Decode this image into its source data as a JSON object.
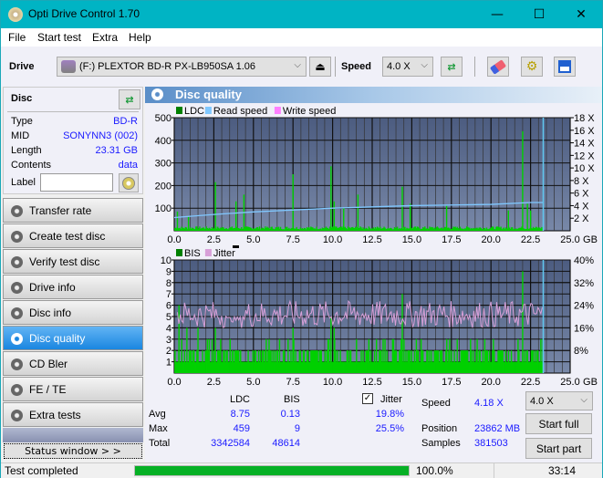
{
  "window": {
    "title": "Opti Drive Control 1.70",
    "minimize": "—",
    "maximize": "☐",
    "close": "✕"
  },
  "menu": {
    "file": "File",
    "start_test": "Start test",
    "extra": "Extra",
    "help": "Help"
  },
  "toolbar": {
    "drive_label": "Drive",
    "drive_value": "(F:)  PLEXTOR BD-R  PX-LB950SA 1.06",
    "speed_label": "Speed",
    "speed_value": "4.0 X"
  },
  "disc": {
    "title": "Disc",
    "type_label": "Type",
    "type_value": "BD-R",
    "mid_label": "MID",
    "mid_value": "SONYNN3 (002)",
    "length_label": "Length",
    "length_value": "23.31 GB",
    "contents_label": "Contents",
    "contents_value": "data",
    "label_label": "Label",
    "label_value": ""
  },
  "nav": [
    {
      "label": "Transfer rate",
      "active": false
    },
    {
      "label": "Create test disc",
      "active": false
    },
    {
      "label": "Verify test disc",
      "active": false
    },
    {
      "label": "Drive info",
      "active": false
    },
    {
      "label": "Disc info",
      "active": false
    },
    {
      "label": "Disc quality",
      "active": true
    },
    {
      "label": "CD Bler",
      "active": false
    },
    {
      "label": "FE / TE",
      "active": false
    },
    {
      "label": "Extra tests",
      "active": false
    }
  ],
  "status_window_label": "Status window > >",
  "main": {
    "title": "Disc quality"
  },
  "colors": {
    "ldc": "#008000",
    "read_speed": "#80c8ff",
    "write_speed": "#ff80ff",
    "bis": "#008000",
    "jitter": "#d8a0d8",
    "bars": "#00d000",
    "progress": "#06b025"
  },
  "chart_data": [
    {
      "type": "bar",
      "title": "LDC / Read speed",
      "legend": [
        "LDC",
        "Read speed",
        "Write speed"
      ],
      "xlabel": "GB",
      "x_ticks": [
        "0.0",
        "2.5",
        "5.0",
        "7.5",
        "10.0",
        "12.5",
        "15.0",
        "17.5",
        "20.0",
        "22.5",
        "25.0"
      ],
      "xlim": [
        0,
        25
      ],
      "y_ticks_left": [
        "500",
        "400",
        "300",
        "200",
        "100"
      ],
      "ylim_left": [
        0,
        500
      ],
      "y_ticks_right": [
        "18 X",
        "16 X",
        "14 X",
        "12 X",
        "10 X",
        "8 X",
        "6 X",
        "4 X",
        "2 X"
      ],
      "ylim_right": [
        0,
        18
      ],
      "ldc_spikes": [
        [
          0.2,
          85
        ],
        [
          0.9,
          65
        ],
        [
          2.6,
          215
        ],
        [
          3.9,
          130
        ],
        [
          4.4,
          160
        ],
        [
          7.5,
          250
        ],
        [
          9.9,
          285
        ],
        [
          10.1,
          130
        ],
        [
          10.7,
          100
        ],
        [
          11.6,
          160
        ],
        [
          14.4,
          195
        ],
        [
          14.9,
          120
        ],
        [
          17.2,
          110
        ],
        [
          21.1,
          90
        ],
        [
          22.0,
          440
        ],
        [
          22.3,
          120
        ],
        [
          22.5,
          90
        ]
      ],
      "ldc_baseline": 15,
      "read_speed": [
        [
          0,
          2.1
        ],
        [
          1,
          2.3
        ],
        [
          2.5,
          2.6
        ],
        [
          5,
          3.0
        ],
        [
          7.5,
          3.3
        ],
        [
          10,
          3.6
        ],
        [
          12.5,
          3.8
        ],
        [
          15,
          4.0
        ],
        [
          17.5,
          4.1
        ],
        [
          20,
          4.2
        ],
        [
          22.5,
          4.5
        ],
        [
          23.3,
          4.5
        ]
      ],
      "end_marker_gb": 23.3
    },
    {
      "type": "bar",
      "title": "BIS / Jitter",
      "legend": [
        "BIS",
        "Jitter"
      ],
      "xlabel": "GB",
      "x_ticks": [
        "0.0",
        "2.5",
        "5.0",
        "7.5",
        "10.0",
        "12.5",
        "15.0",
        "17.5",
        "20.0",
        "22.5",
        "25.0"
      ],
      "xlim": [
        0,
        25
      ],
      "y_ticks_left": [
        "10",
        "9",
        "8",
        "7",
        "6",
        "5",
        "4",
        "3",
        "2",
        "1"
      ],
      "ylim_left": [
        0,
        10
      ],
      "y_ticks_right": [
        "40%",
        "32%",
        "24%",
        "16%",
        "8%"
      ],
      "ylim_right": [
        0,
        40
      ],
      "bis_spikes": [
        [
          0.3,
          6
        ],
        [
          0.8,
          4
        ],
        [
          1.5,
          4
        ],
        [
          2.6,
          4
        ],
        [
          7.5,
          4
        ],
        [
          9.9,
          5
        ],
        [
          10.1,
          4
        ],
        [
          14.4,
          7
        ],
        [
          22.0,
          9
        ]
      ],
      "bis_baseline": 2,
      "jitter_range": [
        16,
        25.5
      ],
      "end_marker_gb": 23.3
    }
  ],
  "stats": {
    "col_ldc": "LDC",
    "col_bis": "BIS",
    "jitter_label": "Jitter",
    "jitter_checked": true,
    "avg_label": "Avg",
    "avg_ldc": "8.75",
    "avg_bis": "0.13",
    "avg_jitter": "19.8%",
    "max_label": "Max",
    "max_ldc": "459",
    "max_bis": "9",
    "max_jitter": "25.5%",
    "total_label": "Total",
    "total_ldc": "3342584",
    "total_bis": "48614",
    "speed_label": "Speed",
    "speed_value": "4.18 X",
    "position_label": "Position",
    "position_value": "23862 MB",
    "samples_label": "Samples",
    "samples_value": "381503",
    "speed_select": "4.0 X",
    "start_full": "Start full",
    "start_part": "Start part"
  },
  "statusbar": {
    "text": "Test completed",
    "progress": 100.0,
    "progress_text": "100.0%",
    "time": "33:14"
  }
}
